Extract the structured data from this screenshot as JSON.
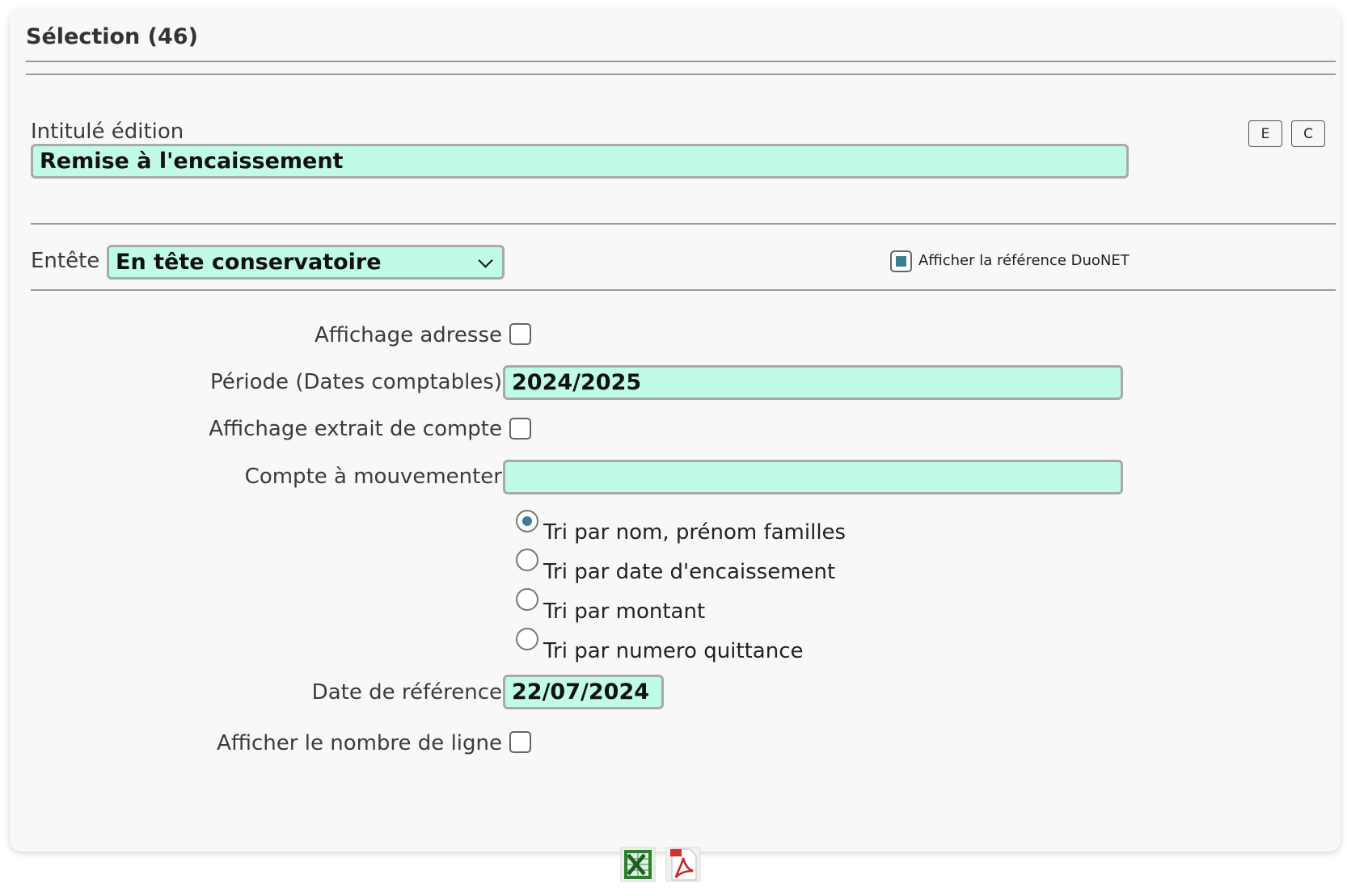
{
  "panel": {
    "title": "Sélection (46)"
  },
  "edition": {
    "label": "Intitulé édition",
    "value": "Remise à l'encaissement",
    "btn_e": "E",
    "btn_c": "C"
  },
  "entete": {
    "label": "Entête",
    "selected": "En tête conservatoire",
    "duonet_label": "Afficher la référence DuoNET",
    "duonet_checked": true
  },
  "form": {
    "affichage_adresse": {
      "label": "Affichage adresse",
      "checked": false
    },
    "periode": {
      "label": "Période (Dates comptables)",
      "value": "2024/2025"
    },
    "extrait_compte": {
      "label": "Affichage extrait de compte",
      "checked": false
    },
    "compte": {
      "label": "Compte à mouvementer",
      "value": ""
    },
    "tri_options": [
      {
        "label": "Tri par nom, prénom familles",
        "checked": true
      },
      {
        "label": "Tri par date d'encaissement",
        "checked": false
      },
      {
        "label": "Tri par montant",
        "checked": false
      },
      {
        "label": "Tri par numero quittance",
        "checked": false
      }
    ],
    "date_reference": {
      "label": "Date de référence",
      "value": "22/07/2024"
    },
    "nombre_ligne": {
      "label": "Afficher le nombre de ligne",
      "checked": false
    }
  },
  "export": {
    "excel_icon": "excel-icon",
    "pdf_icon": "pdf-icon"
  },
  "colors": {
    "field_bg": "#c0fbe6",
    "accent": "#3b7f93"
  }
}
